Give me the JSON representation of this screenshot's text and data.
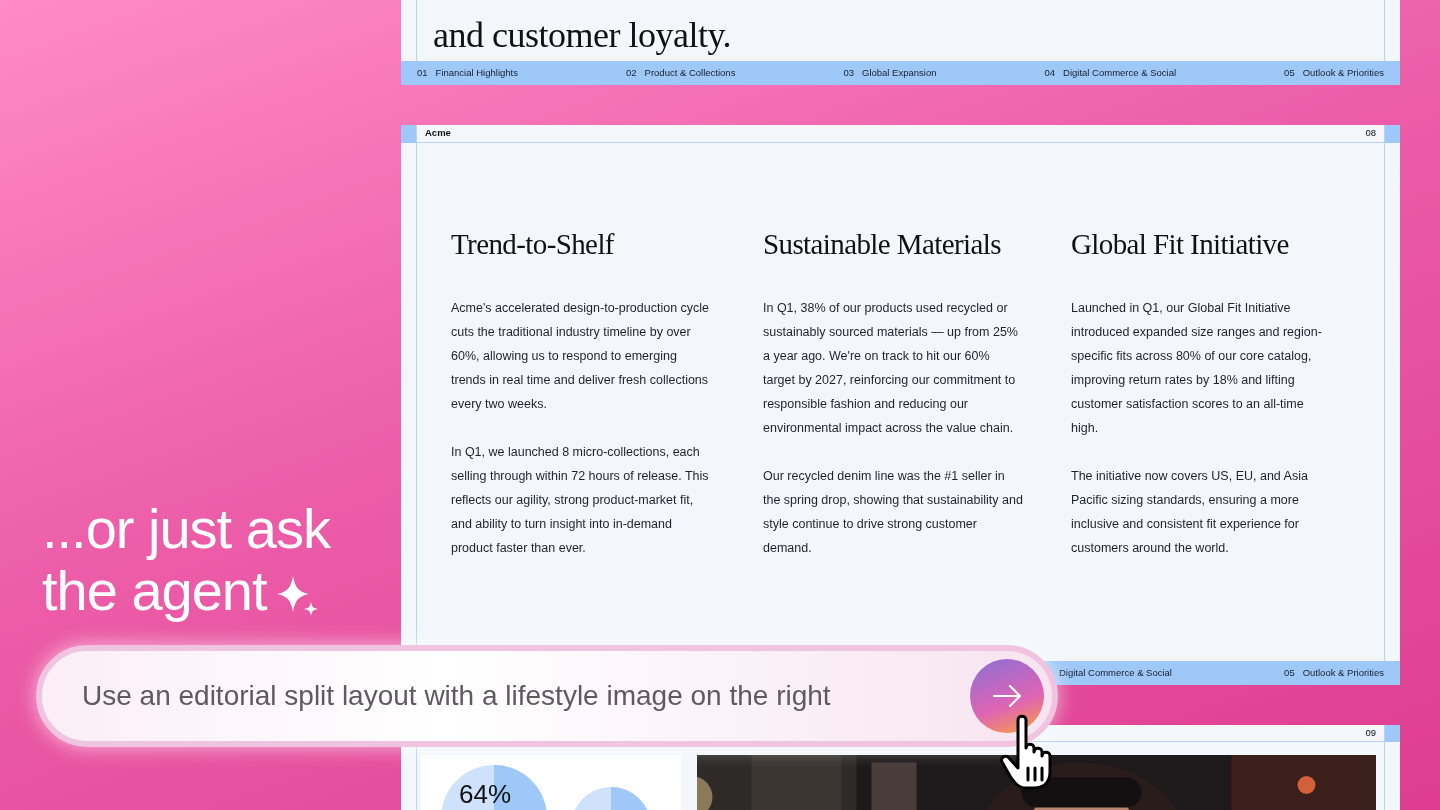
{
  "headline": {
    "lines": [
      "...or just ask",
      "the agent"
    ]
  },
  "slide_top": {
    "heading": "and customer loyalty.",
    "footer": [
      {
        "number": "01",
        "label": "Financial Highlights"
      },
      {
        "number": "02",
        "label": "Product & Collections"
      },
      {
        "number": "03",
        "label": "Global Expansion"
      },
      {
        "number": "04",
        "label": "Digital Commerce & Social"
      },
      {
        "number": "05",
        "label": "Outlook & Priorities"
      }
    ]
  },
  "slide_main": {
    "brand": "Acme",
    "page": "08",
    "columns": [
      {
        "title": "Trend-to-Shelf",
        "paragraphs": [
          "Acme's accelerated design-to-production cycle cuts the traditional industry timeline by over 60%, allowing us to respond to emerging trends in real time and deliver fresh collections every two weeks.",
          "In Q1, we launched 8 micro-collections, each selling through within 72 hours of release. This reflects our agility, strong product-market fit, and ability to turn insight into in-demand product faster than ever."
        ]
      },
      {
        "title": "Sustainable Materials",
        "paragraphs": [
          "In Q1, 38% of our products used recycled or sustainably sourced materials — up from 25% a year ago. We're on track to hit our 60% target by 2027, reinforcing our commitment to responsible fashion and reducing our environmental impact across the value chain.",
          "Our recycled denim line was the #1 seller in the spring drop, showing that sustainability and style continue to drive strong customer demand."
        ]
      },
      {
        "title": "Global Fit Initiative",
        "paragraphs": [
          "Launched in Q1, our Global Fit Initiative introduced expanded size ranges and region-specific fits across 80% of our core catalog, improving return rates by 18% and lifting customer satisfaction scores to an all-time high.",
          "The initiative now covers US, EU, and Asia Pacific sizing standards, ensuring a more inclusive and consistent fit experience for customers around the world."
        ]
      }
    ],
    "footer": [
      {
        "label": "Digital Commerce & Social"
      },
      {
        "number": "05",
        "label": "Outlook & Priorities"
      }
    ]
  },
  "slide_next": {
    "page": "09",
    "stat": "64%"
  },
  "prompt": {
    "value": "Use an editorial split layout with a lifestyle image on the right"
  }
}
